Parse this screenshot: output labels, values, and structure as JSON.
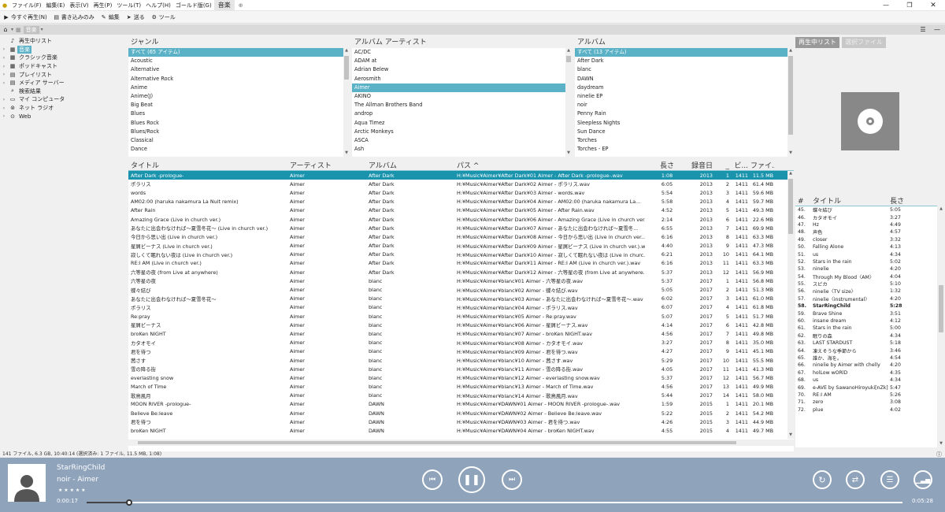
{
  "menu": {
    "items": [
      "ファイル(F)",
      "編集(E)",
      "表示(V)",
      "再生(P)",
      "ツール(T)",
      "ヘルプ(H)",
      "ゴールド版(G)"
    ],
    "tab": "音楽"
  },
  "toolbar": {
    "items": [
      "今すぐ再生(N)",
      "書き込みのみ",
      "編集",
      "送る",
      "ツール"
    ]
  },
  "addr": {
    "path": "音楽"
  },
  "tree": [
    {
      "label": "再生中リスト",
      "icon": "nowplaying-icon",
      "arrow": "",
      "sel": false
    },
    {
      "label": "音楽",
      "icon": "music-icon",
      "arrow": "›",
      "sel": true
    },
    {
      "label": "クラシック音楽",
      "icon": "classical-icon",
      "arrow": "›",
      "sel": false
    },
    {
      "label": "ポッドキャスト",
      "icon": "podcast-icon",
      "arrow": "›",
      "sel": false
    },
    {
      "label": "プレイリスト",
      "icon": "playlist-icon",
      "arrow": "›",
      "sel": false
    },
    {
      "label": "メディア サーバー",
      "icon": "server-icon",
      "arrow": "›",
      "sel": false
    },
    {
      "label": "検索結果",
      "icon": "search-icon",
      "arrow": "",
      "sel": false
    },
    {
      "label": "マイ コンピュータ",
      "icon": "computer-icon",
      "arrow": "›",
      "sel": false
    },
    {
      "label": "ネット ラジオ",
      "icon": "radio-icon",
      "arrow": "›",
      "sel": false
    },
    {
      "label": "Web",
      "icon": "web-icon",
      "arrow": "›",
      "sel": false
    }
  ],
  "genre": {
    "header": "ジャンル",
    "items": [
      "すべて (65 アイテム)",
      "Acoustic",
      "Alternative",
      "Alternative Rock",
      "Anime",
      "Anime(J)",
      "Big Beat",
      "Blues",
      "Blues Rock",
      "Blues/Rock",
      "Classical",
      "Dance"
    ]
  },
  "artist": {
    "header": "アルバム アーティスト",
    "items": [
      "AC/DC",
      "ADAM at",
      "Adrian Belew",
      "Aerosmith",
      "Aimer",
      "AKINO",
      "The Allman Brothers Band",
      "androp",
      "Aqua Timez",
      "Arctic Monkeys",
      "ASCA",
      "Ash"
    ]
  },
  "album": {
    "header": "アルバム",
    "items": [
      "すべて (13 アイテム)",
      "After Dark",
      "blanc",
      "DAWN",
      "daydream",
      "ninelie EP",
      "noir",
      "Penny Rain",
      "Sleepless Nights",
      "Sun Dance",
      "Torches",
      "Torches - EP"
    ]
  },
  "main": {
    "headers": [
      "タイトル",
      "アーティスト",
      "アルバム",
      "パス ^",
      "長さ",
      "録音日",
      "_",
      "ビ...",
      "ファイ..."
    ],
    "rows": [
      [
        "After Dark -prologue-",
        "Aimer",
        "After Dark",
        "H:¥Music¥Aimer¥After Dark¥01 Aimer - After Dark -prologue-.wav",
        "1:08",
        "2013",
        "1",
        "1411",
        "11.5 MB"
      ],
      [
        "ポラリス",
        "Aimer",
        "After Dark",
        "H:¥Music¥Aimer¥After Dark¥02 Aimer - ポラリス.wav",
        "6:05",
        "2013",
        "2",
        "1411",
        "61.4 MB"
      ],
      [
        "words",
        "Aimer",
        "After Dark",
        "H:¥Music¥Aimer¥After Dark¥03 Aimer - words.wav",
        "5:54",
        "2013",
        "3",
        "1411",
        "59.6 MB"
      ],
      [
        "AM02:00 (haruka nakamura La Nuit remix)",
        "Aimer",
        "After Dark",
        "H:¥Music¥Aimer¥After Dark¥04 Aimer - AM02:00 (haruka nakamura La...",
        "5:58",
        "2013",
        "4",
        "1411",
        "59.7 MB"
      ],
      [
        "After Rain",
        "Aimer",
        "After Dark",
        "H:¥Music¥Aimer¥After Dark¥05 Aimer - After Rain.wav",
        "4:52",
        "2013",
        "5",
        "1411",
        "49.3 MB"
      ],
      [
        "Amazing Grace (Live in church ver.)",
        "Aimer",
        "After Dark",
        "H:¥Music¥Aimer¥After Dark¥06 Aimer - Amazing Grace (Live in church ver.)...",
        "2:14",
        "2013",
        "6",
        "1411",
        "22.6 MB"
      ],
      [
        "あなたに出会わなければ〜夏雪冬花〜 (Live in church ver.)",
        "Aimer",
        "After Dark",
        "H:¥Music¥Aimer¥After Dark¥07 Aimer - あなたに出会わなければ〜夏雪冬...",
        "6:55",
        "2013",
        "7",
        "1411",
        "69.9 MB"
      ],
      [
        "今日から思い出 (Live in church ver.)",
        "Aimer",
        "After Dark",
        "H:¥Music¥Aimer¥After Dark¥08 Aimer - 今日から思い出 (Live in church ver...",
        "6:16",
        "2013",
        "8",
        "1411",
        "63.3 MB"
      ],
      [
        "星屑ビーナス (Live in church ver.)",
        "Aimer",
        "After Dark",
        "H:¥Music¥Aimer¥After Dark¥09 Aimer - 星屑ビーナス (Live in church ver.).wav",
        "4:40",
        "2013",
        "9",
        "1411",
        "47.3 MB"
      ],
      [
        "寂しくて眠れない夜は (Live in church ver.)",
        "Aimer",
        "After Dark",
        "H:¥Music¥Aimer¥After Dark¥10 Aimer - 寂しくて眠れない夜は (Live in churc...",
        "6:21",
        "2013",
        "10",
        "1411",
        "64.1 MB"
      ],
      [
        "RE:I AM (Live in church ver.)",
        "Aimer",
        "After Dark",
        "H:¥Music¥Aimer¥After Dark¥11 Aimer - RE:I AM (Live in church ver.).wav",
        "6:16",
        "2013",
        "11",
        "1411",
        "63.3 MB"
      ],
      [
        "六等星の夜 (from Live at anywhere)",
        "Aimer",
        "After Dark",
        "H:¥Music¥Aimer¥After Dark¥12 Aimer - 六等星の夜 (from Live at anywhere...",
        "5:37",
        "2013",
        "12",
        "1411",
        "56.9 MB"
      ],
      [
        "六等星の夜",
        "Aimer",
        "blanc",
        "H:¥Music¥Aimer¥blanc¥01 Aimer - 六等星の夜.wav",
        "5:37",
        "2017",
        "1",
        "1411",
        "56.8 MB"
      ],
      [
        "蝶々結び",
        "Aimer",
        "blanc",
        "H:¥Music¥Aimer¥blanc¥02 Aimer - 蝶々結び.wav",
        "5:05",
        "2017",
        "2",
        "1411",
        "51.3 MB"
      ],
      [
        "あなたに出会わなければ〜夏雪冬花〜",
        "Aimer",
        "blanc",
        "H:¥Music¥Aimer¥blanc¥03 Aimer - あなたに出会わなければ〜夏雪冬花〜.wav",
        "6:02",
        "2017",
        "3",
        "1411",
        "61.0 MB"
      ],
      [
        "ポラリス",
        "Aimer",
        "blanc",
        "H:¥Music¥Aimer¥blanc¥04 Aimer - ポラリス.wav",
        "6:07",
        "2017",
        "4",
        "1411",
        "61.8 MB"
      ],
      [
        "Re:pray",
        "Aimer",
        "blanc",
        "H:¥Music¥Aimer¥blanc¥05 Aimer - Re:pray.wav",
        "5:07",
        "2017",
        "5",
        "1411",
        "51.7 MB"
      ],
      [
        "星屑ビーナス",
        "Aimer",
        "blanc",
        "H:¥Music¥Aimer¥blanc¥06 Aimer - 星屑ビーナス.wav",
        "4:14",
        "2017",
        "6",
        "1411",
        "42.8 MB"
      ],
      [
        "broKen NIGHT",
        "Aimer",
        "blanc",
        "H:¥Music¥Aimer¥blanc¥07 Aimer - broKen NIGHT.wav",
        "4:56",
        "2017",
        "7",
        "1411",
        "49.8 MB"
      ],
      [
        "カタオモイ",
        "Aimer",
        "blanc",
        "H:¥Music¥Aimer¥blanc¥08 Aimer - カタオモイ.wav",
        "3:27",
        "2017",
        "8",
        "1411",
        "35.0 MB"
      ],
      [
        "君を待つ",
        "Aimer",
        "blanc",
        "H:¥Music¥Aimer¥blanc¥09 Aimer - 君を待つ.wav",
        "4:27",
        "2017",
        "9",
        "1411",
        "45.1 MB"
      ],
      [
        "茜さす",
        "Aimer",
        "blanc",
        "H:¥Music¥Aimer¥blanc¥10 Aimer - 茜さす.wav",
        "5:29",
        "2017",
        "10",
        "1411",
        "55.5 MB"
      ],
      [
        "雪の降る街",
        "Aimer",
        "blanc",
        "H:¥Music¥Aimer¥blanc¥11 Aimer - 雪の降る街.wav",
        "4:05",
        "2017",
        "11",
        "1411",
        "41.3 MB"
      ],
      [
        "everlasting snow",
        "Aimer",
        "blanc",
        "H:¥Music¥Aimer¥blanc¥12 Aimer - everlasting snow.wav",
        "5:37",
        "2017",
        "12",
        "1411",
        "56.7 MB"
      ],
      [
        "March of Time",
        "Aimer",
        "blanc",
        "H:¥Music¥Aimer¥blanc¥13 Aimer - March of Time.wav",
        "4:56",
        "2017",
        "13",
        "1411",
        "49.9 MB"
      ],
      [
        "歌鳥風月",
        "Aimer",
        "blanc",
        "H:¥Music¥Aimer¥blanc¥14 Aimer - 歌鳥風月.wav",
        "5:44",
        "2017",
        "14",
        "1411",
        "58.0 MB"
      ],
      [
        "MOON RIVER -prologue-",
        "Aimer",
        "DAWN",
        "H:¥Music¥Aimer¥DAWN¥01 Aimer - MOON RIVER -prologue-.wav",
        "1:59",
        "2015",
        "1",
        "1411",
        "20.1 MB"
      ],
      [
        "Believe Be:leave",
        "Aimer",
        "DAWN",
        "H:¥Music¥Aimer¥DAWN¥02 Aimer - Believe Be:leave.wav",
        "5:22",
        "2015",
        "2",
        "1411",
        "54.2 MB"
      ],
      [
        "君を待つ",
        "Aimer",
        "DAWN",
        "H:¥Music¥Aimer¥DAWN¥03 Aimer - 君を待つ.wav",
        "4:26",
        "2015",
        "3",
        "1411",
        "44.9 MB"
      ],
      [
        "broKen NIGHT",
        "Aimer",
        "DAWN",
        "H:¥Music¥Aimer¥DAWN¥04 Aimer - broKen NIGHT.wav",
        "4:55",
        "2015",
        "4",
        "1411",
        "49.7 MB"
      ]
    ]
  },
  "rtabs": [
    "再生中リスト",
    "選択ファイル"
  ],
  "playlist": {
    "headers": [
      "#",
      "タイトル",
      "長さ"
    ],
    "rows": [
      [
        "45.",
        "蝶々結び",
        "5:05",
        false
      ],
      [
        "46.",
        "カタオモイ",
        "3:27",
        false
      ],
      [
        "47.",
        "Hz",
        "4:49",
        false
      ],
      [
        "48.",
        "声色",
        "4:57",
        false
      ],
      [
        "49.",
        "closer",
        "3:32",
        false
      ],
      [
        "50.",
        "Falling Alone",
        "4:13",
        false
      ],
      [
        "51.",
        "us",
        "4:34",
        false
      ],
      [
        "52.",
        "Stars in the rain",
        "5:02",
        false
      ],
      [
        "53.",
        "ninelie",
        "4:20",
        false
      ],
      [
        "54.",
        "Through My Blood〈AM〉",
        "4:04",
        false
      ],
      [
        "55.",
        "スピカ",
        "5:10",
        false
      ],
      [
        "56.",
        "ninelie〈TV size〉",
        "1:32",
        false
      ],
      [
        "57.",
        "ninelie〈instrumental〉",
        "4:20",
        false
      ],
      [
        "58.",
        "StarRingChild",
        "5:28",
        true
      ],
      [
        "59.",
        "Brave Shine",
        "3:51",
        false
      ],
      [
        "60.",
        "insane dream",
        "4:12",
        false
      ],
      [
        "61.",
        "Stars in the rain",
        "5:00",
        false
      ],
      [
        "62.",
        "眠りの森",
        "4:34",
        false
      ],
      [
        "63.",
        "LAST STARDUST",
        "5:18",
        false
      ],
      [
        "64.",
        "凍えそうな季節から",
        "3:46",
        false
      ],
      [
        "65.",
        "誰か、海を。",
        "4:54",
        false
      ],
      [
        "66.",
        "ninelie by Aimer with chelly",
        "4:20",
        false
      ],
      [
        "67.",
        "holLow wORlD",
        "4:35",
        false
      ],
      [
        "68.",
        "us",
        "4:34",
        false
      ],
      [
        "69.",
        "e-AVE by SawanoHiroyuki[nZk]",
        "5:47",
        false
      ],
      [
        "70.",
        "RE:I AM",
        "5:26",
        false
      ],
      [
        "71.",
        "zero",
        "3:08",
        false
      ],
      [
        "72.",
        "plue",
        "4:02",
        false
      ]
    ]
  },
  "status": "141 ファイル, 6.3 GB, 10:40:14 (選択済み: 1 ファイル, 11.5 MB, 1:08)",
  "player": {
    "title": "StarRingChild",
    "subtitle": "noir - Aimer",
    "rating": "★ ★ ★ ★ ★",
    "elapsed": "0:00:17",
    "total": "0:05:28",
    "progress": 0.052
  },
  "colors": {
    "accent": "#5bb1c5",
    "selected_row": "#1a93ad",
    "player_bg": "#8fa3bb"
  }
}
